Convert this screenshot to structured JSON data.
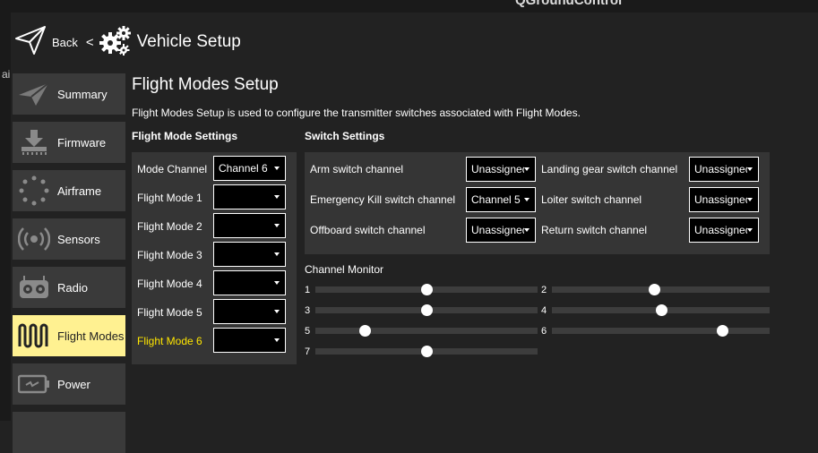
{
  "app_title": "QGroundControl",
  "left_clip_text": "ai",
  "toolbar": {
    "back_label": "Back",
    "separator": "<",
    "page_title": "Vehicle Setup"
  },
  "sidebar": {
    "items": [
      {
        "label": "Summary",
        "icon": "paper-plane-icon"
      },
      {
        "label": "Firmware",
        "icon": "download-icon"
      },
      {
        "label": "Airframe",
        "icon": "airframe-icon"
      },
      {
        "label": "Sensors",
        "icon": "sensors-icon"
      },
      {
        "label": "Radio",
        "icon": "radio-icon"
      },
      {
        "label": "Flight Modes",
        "icon": "flight-modes-icon",
        "active": true
      },
      {
        "label": "Power",
        "icon": "battery-icon"
      }
    ]
  },
  "main": {
    "title": "Flight Modes Setup",
    "description": "Flight Modes Setup is used to configure the transmitter switches associated with Flight Modes.",
    "flight_mode_settings": {
      "heading": "Flight Mode Settings",
      "mode_channel": {
        "label": "Mode Channel",
        "value": "Channel 6"
      },
      "modes": [
        {
          "label": "Flight Mode 1",
          "value": ""
        },
        {
          "label": "Flight Mode 2",
          "value": ""
        },
        {
          "label": "Flight Mode 3",
          "value": ""
        },
        {
          "label": "Flight Mode 4",
          "value": ""
        },
        {
          "label": "Flight Mode 5",
          "value": ""
        },
        {
          "label": "Flight Mode 6",
          "value": "",
          "highlighted": true
        }
      ]
    },
    "switch_settings": {
      "heading": "Switch Settings",
      "switches": [
        {
          "label": "Arm switch channel",
          "value": "Unassigned"
        },
        {
          "label": "Landing gear switch channel",
          "value": "Unassigned"
        },
        {
          "label": "Emergency Kill switch channel",
          "value": "Channel 5"
        },
        {
          "label": "Loiter switch channel",
          "value": "Unassigned"
        },
        {
          "label": "Offboard switch channel",
          "value": "Unassigned"
        },
        {
          "label": "Return switch channel",
          "value": "Unassigned"
        }
      ]
    },
    "channel_monitor": {
      "heading": "Channel Monitor",
      "channels": [
        {
          "label": "1",
          "value": 0.5
        },
        {
          "label": "2",
          "value": 0.47
        },
        {
          "label": "3",
          "value": 0.5
        },
        {
          "label": "4",
          "value": 0.5
        },
        {
          "label": "5",
          "value": 0.22
        },
        {
          "label": "6",
          "value": 0.78
        },
        {
          "label": "7",
          "value": 0.5
        }
      ]
    }
  },
  "colors": {
    "background": "#222222",
    "panel": "#353535",
    "nav_button": "#3a3a3a",
    "active_nav": "#fff191",
    "highlight_text": "#ffe600"
  }
}
